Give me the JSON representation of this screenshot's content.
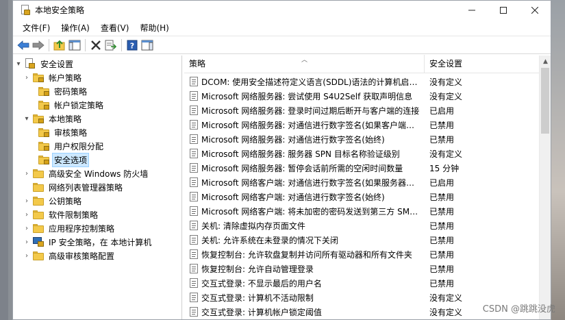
{
  "window": {
    "title": "本地安全策略"
  },
  "menu": [
    "文件(F)",
    "操作(A)",
    "查看(V)",
    "帮助(H)"
  ],
  "tree": {
    "root": "安全设置",
    "account_policies": "帐户策略",
    "password_policy": "密码策略",
    "lockout_policy": "帐户锁定策略",
    "local_policies": "本地策略",
    "audit_policy": "审核策略",
    "user_rights": "用户权限分配",
    "security_options": "安全选项",
    "firewall": "高级安全 Windows 防火墙",
    "network_list": "网络列表管理器策略",
    "public_key": "公钥策略",
    "software_restriction": "软件限制策略",
    "app_control": "应用程序控制策略",
    "ipsec": "IP 安全策略，在 本地计算机",
    "advanced_audit": "高级审核策略配置"
  },
  "list": {
    "col_policy": "策略",
    "col_setting": "安全设置",
    "rows": [
      {
        "policy": "DCOM: 使用安全描述符定义语言(SDDL)语法的计算机启动...",
        "setting": "没有定义"
      },
      {
        "policy": "Microsoft 网络服务器: 尝试使用 S4U2Self 获取声明信息",
        "setting": "没有定义"
      },
      {
        "policy": "Microsoft 网络服务器: 登录时间过期后断开与客户端的连接",
        "setting": "已启用"
      },
      {
        "policy": "Microsoft 网络服务器: 对通信进行数字签名(如果客户端允...",
        "setting": "已禁用"
      },
      {
        "policy": "Microsoft 网络服务器: 对通信进行数字签名(始终)",
        "setting": "已禁用"
      },
      {
        "policy": "Microsoft 网络服务器: 服务器 SPN 目标名称验证级别",
        "setting": "没有定义"
      },
      {
        "policy": "Microsoft 网络服务器: 暂停会话前所需的空闲时间数量",
        "setting": "15 分钟"
      },
      {
        "policy": "Microsoft 网络客户端: 对通信进行数字签名(如果服务器允...",
        "setting": "已启用"
      },
      {
        "policy": "Microsoft 网络客户端: 对通信进行数字签名(始终)",
        "setting": "已禁用"
      },
      {
        "policy": "Microsoft 网络客户端: 将未加密的密码发送到第三方 SMB...",
        "setting": "已禁用"
      },
      {
        "policy": "关机: 清除虚拟内存页面文件",
        "setting": "已禁用"
      },
      {
        "policy": "关机: 允许系统在未登录的情况下关闭",
        "setting": "已禁用"
      },
      {
        "policy": "恢复控制台: 允许软盘复制并访问所有驱动器和所有文件夹",
        "setting": "已禁用"
      },
      {
        "policy": "恢复控制台: 允许自动管理登录",
        "setting": "已禁用"
      },
      {
        "policy": "交互式登录: 不显示最后的用户名",
        "setting": "已禁用"
      },
      {
        "policy": "交互式登录: 计算机不活动限制",
        "setting": "没有定义"
      },
      {
        "policy": "交互式登录: 计算机帐户锁定阈值",
        "setting": "没有定义"
      }
    ]
  },
  "watermark": "CSDN @跳跳没虎"
}
